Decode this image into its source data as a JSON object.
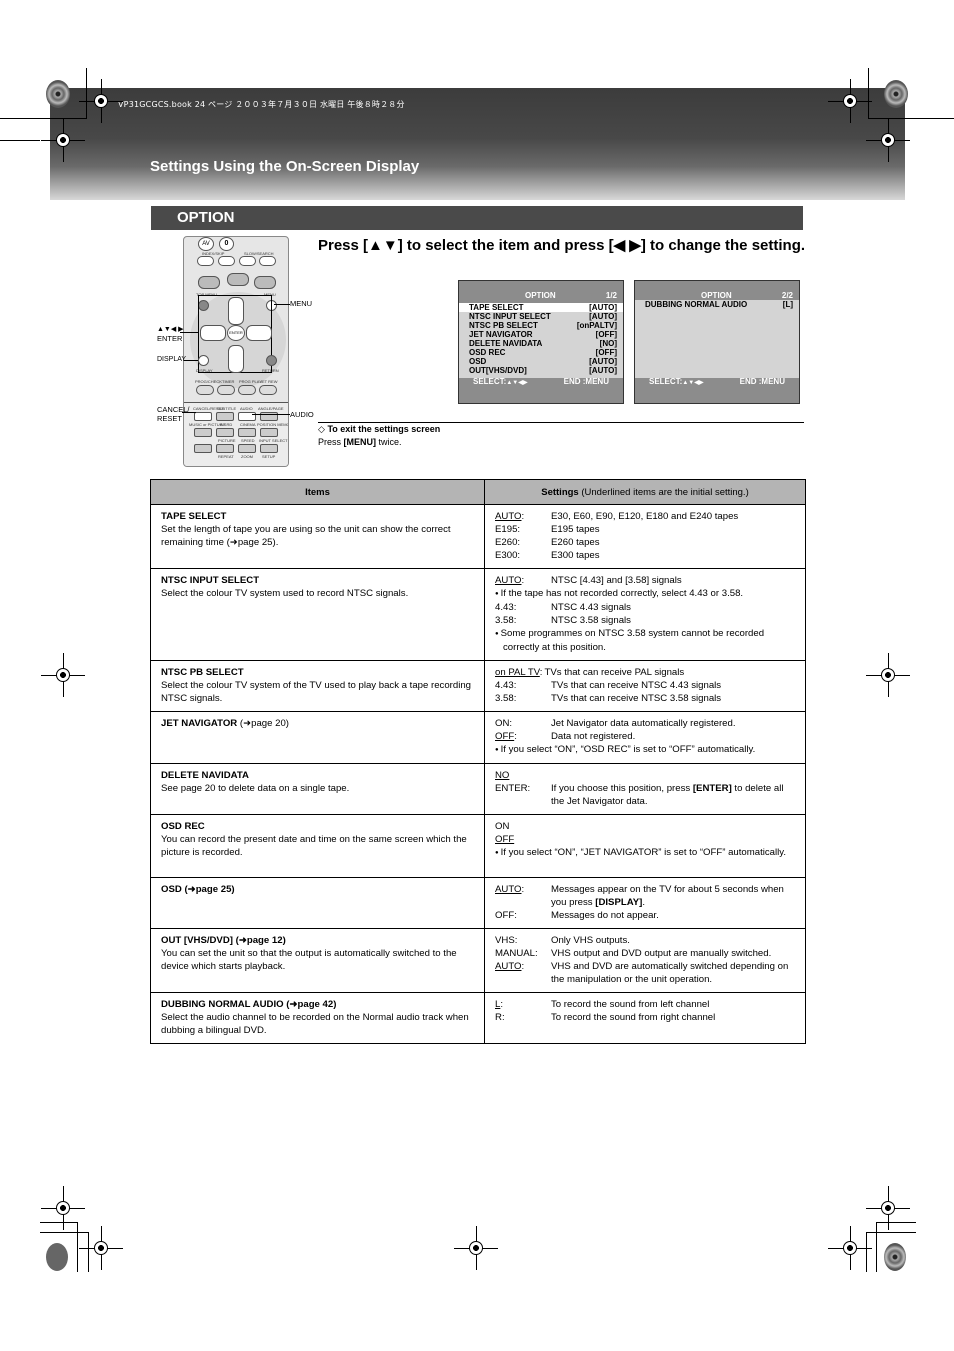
{
  "header": {
    "book_line": "VP31GCGCS.book  24 ページ  ２００３年７月３０日  水曜日  午後８時２８分",
    "page_title": "Settings Using the On-Screen Display"
  },
  "section": {
    "title": "OPTION"
  },
  "remote": {
    "callouts": {
      "menu": "MENU",
      "arrows": "▲▼◀ ▶",
      "enter": "ENTER",
      "display": "DISPLAY",
      "cancel": "CANCEL/",
      "reset": "RESET",
      "audio": "AUDIO"
    },
    "button_labels": {
      "av": "AV",
      "zero": "0",
      "index_skip": "INDEX/SKIP",
      "slow_search": "SLOW/SEARCH",
      "top_menu": "TOP MENU",
      "menu": "MENU",
      "direct_navigator": "DIRECT NAVIGATOR",
      "play_list": "PLAY LIST",
      "enter": "ENTER",
      "display": "DISPLAY",
      "return": "RETURN",
      "prog_check": "PROG/CHECK",
      "timer": "TIMER",
      "prog_play": "PROG PLAY",
      "jet_rew": "JET REW",
      "cancel_reset": "CANCEL/RESET",
      "subtitle": "SUBTITLE",
      "audio": "AUDIO",
      "angle_page": "ANGLE/PAGE",
      "music_picture": "MUSIC or PICTURE",
      "a_srd": "A.SRD",
      "cinema": "CINEMA",
      "position_memory": "POSITION MEMORY",
      "picture": "PICTURE",
      "speed": "SPEED",
      "input_select": "INPUT SELECT",
      "repeat": "REPEAT",
      "zoom": "ZOOM",
      "setup": "SETUP"
    }
  },
  "instruction": "Press [▲▼] to select the item and press [◀ ▶] to change the setting.",
  "osd_screens": [
    {
      "title": "OPTION",
      "page": "1/2",
      "rows": [
        {
          "label": "TAPE SELECT",
          "value": "[AUTO]",
          "selected": true
        },
        {
          "label": "NTSC INPUT SELECT",
          "value": "[AUTO]"
        },
        {
          "label": "NTSC PB SELECT",
          "value": "[onPALTV]"
        },
        {
          "label": "JET NAVIGATOR",
          "value": "[OFF]"
        },
        {
          "label": "DELETE NAVIDATA",
          "value": "[NO]"
        },
        {
          "label": "OSD REC",
          "value": "[OFF]"
        },
        {
          "label": "OSD",
          "value": "[AUTO]"
        },
        {
          "label": "OUT[VHS/DVD]",
          "value": "[AUTO]"
        }
      ],
      "select_label": "SELECT:",
      "select_keys": "▲▼◀▶",
      "end_label": "END :MENU"
    },
    {
      "title": "OPTION",
      "page": "2/2",
      "rows": [
        {
          "label": "DUBBING NORMAL AUDIO",
          "value": "[L]"
        }
      ],
      "select_label": "SELECT:",
      "select_keys": "▲▼◀▶",
      "end_label": "END :MENU"
    }
  ],
  "exit": {
    "icon": "diamond-outline",
    "title": "To exit the settings screen",
    "text_prefix": "Press ",
    "text_key": "[MENU]",
    "text_suffix": " twice."
  },
  "table": {
    "header_items": "Items",
    "header_settings": "Settings",
    "header_settings_note": " (Underlined items are the initial setting.)",
    "rows": [
      {
        "name": "TAPE SELECT",
        "ref": "",
        "desc": "Set the length of tape you are using so the unit can show the correct remaining time (➜page 25).",
        "settings": [
          {
            "type": "opt",
            "key": "AUTO",
            "underline": true,
            "text": "E30, E60, E90, E120, E180 and E240 tapes"
          },
          {
            "type": "opt",
            "key": "E195",
            "text": "E195 tapes"
          },
          {
            "type": "opt",
            "key": "E260",
            "text": "E260 tapes"
          },
          {
            "type": "opt",
            "key": "E300",
            "text": "E300 tapes"
          }
        ]
      },
      {
        "name": "NTSC INPUT SELECT",
        "ref": "",
        "desc": "Select the colour TV system used to record NTSC signals.",
        "settings": [
          {
            "type": "opt",
            "key": "AUTO",
            "underline": true,
            "text": "NTSC [4.43] and [3.58] signals"
          },
          {
            "type": "note",
            "text": "If the tape has not recorded correctly, select 4.43 or 3.58."
          },
          {
            "type": "opt",
            "key": "4.43",
            "text": "NTSC 4.43 signals"
          },
          {
            "type": "opt",
            "key": "3.58",
            "text": "NTSC 3.58 signals"
          },
          {
            "type": "note",
            "text": "Some programmes on NTSC 3.58 system cannot be recorded correctly at this position."
          }
        ]
      },
      {
        "name": "NTSC PB SELECT",
        "ref": "",
        "desc": "Select the colour TV system of the TV used to play back a tape recording NTSC signals.",
        "settings": [
          {
            "type": "opt",
            "key": "on PAL TV",
            "underline": true,
            "inline": true,
            "text": "TVs that can receive PAL signals"
          },
          {
            "type": "opt",
            "key": "4.43",
            "text": "TVs that can receive NTSC 4.43 signals"
          },
          {
            "type": "opt",
            "key": "3.58",
            "text": "TVs that can receive NTSC 3.58 signals"
          }
        ]
      },
      {
        "name": "JET NAVIGATOR",
        "ref": " (➜page 20)",
        "ref_bold": false,
        "desc": "",
        "settings": [
          {
            "type": "opt",
            "key": "ON",
            "text": "Jet Navigator data automatically registered."
          },
          {
            "type": "opt",
            "key": "OFF",
            "underline": true,
            "text": "Data not registered."
          },
          {
            "type": "note",
            "text": "If you select “ON”, “OSD REC” is set to “OFF” automatically."
          }
        ]
      },
      {
        "name": "DELETE NAVIDATA",
        "ref": "",
        "desc": "See page 20 to delete data on a single tape.",
        "settings": [
          {
            "type": "plain",
            "key": "NO",
            "underline": true
          },
          {
            "type": "opt",
            "key": "ENTER",
            "text_prefix": "If you choose this position, press ",
            "text_bold": "[ENTER]",
            "text": " to delete all the Jet Navigator data."
          }
        ]
      },
      {
        "name": "OSD REC",
        "ref": "",
        "desc": "You can record the present date and time on the same screen which the picture is recorded.",
        "settings": [
          {
            "type": "plain",
            "key": "ON"
          },
          {
            "type": "plain",
            "key": "OFF",
            "underline": true
          },
          {
            "type": "note",
            "text": "If you select “ON”, “JET NAVIGATOR” is set to “OFF” automatically."
          }
        ]
      },
      {
        "name": "OSD",
        "ref": " (➜page 25)",
        "ref_bold": true,
        "desc": "",
        "settings": [
          {
            "type": "opt",
            "key": "AUTO",
            "underline": true,
            "text_prefix": "Messages appear on the TV for about 5 seconds when you press ",
            "text_bold": "[DISPLAY]",
            "text": "."
          },
          {
            "type": "opt",
            "key": "OFF",
            "text": "Messages do not appear."
          }
        ]
      },
      {
        "name": "OUT [VHS/DVD]",
        "ref": " (➜page 12)",
        "ref_bold": true,
        "desc": "You can set the unit so that the output is automatically switched to the device which starts playback.",
        "settings": [
          {
            "type": "opt",
            "key": "VHS",
            "text": "Only VHS outputs."
          },
          {
            "type": "opt",
            "key": "MANUAL",
            "text": "VHS output and DVD output are manually switched."
          },
          {
            "type": "opt",
            "key": "AUTO",
            "underline": true,
            "text": "VHS and DVD are automatically switched depending on the manipulation or the unit operation."
          }
        ]
      },
      {
        "name": "DUBBING NORMAL AUDIO",
        "ref": " (➜page 42)",
        "ref_bold": true,
        "desc": "Select the audio channel to be recorded on the Normal audio track when dubbing a bilingual DVD.",
        "settings": [
          {
            "type": "opt",
            "key": "L",
            "underline": true,
            "text": "To record the sound from left channel"
          },
          {
            "type": "opt",
            "key": "R",
            "text": "To record the sound from right channel"
          }
        ]
      }
    ]
  }
}
